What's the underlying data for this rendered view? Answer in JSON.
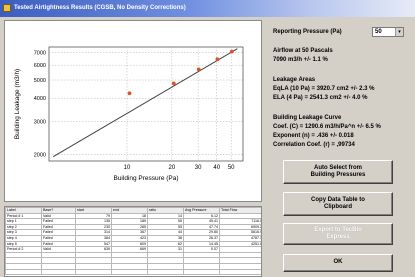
{
  "window": {
    "title": "Tested Airtightness Results (CGSB, No Density Corrections)"
  },
  "reporting": {
    "label": "Reporting Pressure (Pa)",
    "value": "50",
    "arrow": "▾"
  },
  "airflow": {
    "label": "Airflow at 50 Pascals",
    "value": "7090 m3/h +/- 1.1 %"
  },
  "leakage_areas": {
    "heading": "Leakage Areas",
    "eqla": "EqLA (10 Pa) = 3920.7 cm2 +/- 2.3 %",
    "ela": "ELA (4 Pa) = 2541.3 cm2 +/- 4.0 %"
  },
  "curve": {
    "heading": "Building Leakage Curve",
    "coef": "Coef. (C) = 1290.6 m3/h/Pa^n +/- 6.5 %",
    "exponent": "Exponent (n) = .436 +/- 0.018",
    "correlation": "Correlation Coef. (r) = ,99734"
  },
  "buttons": {
    "auto_select": [
      "Auto Select from",
      "Building Pressures"
    ],
    "copy": [
      "Copy Data Table to",
      "Clipboard"
    ],
    "export": [
      "Export to TecBlo",
      "Express"
    ],
    "ok": "OK"
  },
  "chart_data": {
    "type": "scatter",
    "title": "",
    "xlabel": "Building Pressure (Pa)",
    "ylabel": "Building Leakage (m3/h)",
    "x_scale": "log",
    "y_scale": "log",
    "xlim": [
      3,
      60
    ],
    "ylim": [
      1850,
      7500
    ],
    "x_ticks": [
      10,
      20,
      30,
      40,
      50
    ],
    "y_ticks": [
      2000,
      3000,
      4000,
      5000,
      6000,
      7000
    ],
    "grid": true,
    "series": [
      {
        "style": "points",
        "color": "#e05020",
        "x": [
          10.4,
          20.6,
          30.3,
          40.4,
          50.5
        ],
        "y": [
          4250,
          4800,
          5700,
          6450,
          7100
        ]
      },
      {
        "style": "fit-line",
        "color": "#404040",
        "x": [
          3.2,
          55
        ],
        "y": [
          1950,
          7350
        ]
      }
    ]
  },
  "table": {
    "columns": [
      "Label",
      "Base?",
      "start",
      "end",
      "ratio",
      "Avg Pressure",
      "Total Flow"
    ],
    "rows": [
      [
        "Period # 1",
        "Valid",
        "79",
        "18",
        "14",
        "6.12",
        ""
      ],
      [
        "step 1",
        "Failed",
        "135",
        "189",
        "55",
        "45.41",
        "7116.5"
      ],
      [
        "step 2",
        "Failed",
        "230",
        "285",
        "55",
        "47.74",
        "6909.2"
      ],
      [
        "step 3",
        "Failed",
        "314",
        "367",
        "44",
        "29.80",
        "5616.9"
      ],
      [
        "step 4",
        "Failed",
        "384",
        "423",
        "38",
        "26.37",
        "4787.3"
      ],
      [
        "step 5",
        "Failed",
        "547",
        "609",
        "62",
        "14.45",
        "4251.0"
      ],
      [
        "Period # 2",
        "Valid",
        "639",
        "669",
        "31",
        "0.07",
        ""
      ],
      [
        "",
        "",
        "",
        "",
        "",
        "",
        ""
      ],
      [
        "",
        "",
        "",
        "",
        "",
        "",
        ""
      ],
      [
        "",
        "",
        "",
        "",
        "",
        "",
        ""
      ],
      [
        "",
        "",
        "",
        "",
        "",
        "",
        ""
      ]
    ]
  }
}
